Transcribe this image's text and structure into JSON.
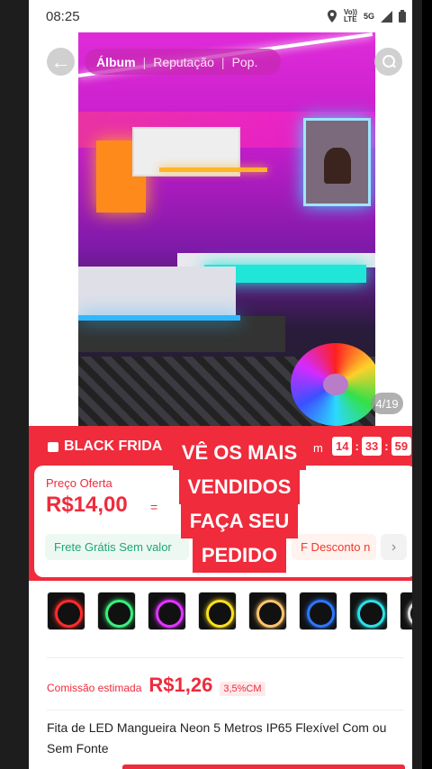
{
  "status_bar": {
    "time": "08:25",
    "volte": "Vo))",
    "lte": "LTE",
    "network": "5G"
  },
  "gallery": {
    "tabs": [
      "Álbum",
      "Reputação",
      "Pop."
    ],
    "separator": "|",
    "counter": "4/19"
  },
  "promo": {
    "banner": "BLACK FRIDA",
    "end_label": "m",
    "timer": [
      "14",
      "33",
      "59"
    ],
    "price_label": "Preço Oferta",
    "price": "R$14,00",
    "equals": "=",
    "chip_free": "Frete Grátis Sem valor",
    "chip_discount": "F Desconto n",
    "chip_arrow": "›"
  },
  "overlay_text": [
    "VÊ OS MAIS",
    "VENDIDOS",
    "FAÇA SEU",
    "PEDIDO"
  ],
  "variants": [
    {
      "color": "#ff2b2b"
    },
    {
      "color": "#39f07a"
    },
    {
      "color": "#e035ff"
    },
    {
      "color": "#ffe01b"
    },
    {
      "color": "#ffc46b"
    },
    {
      "color": "#2b77ff"
    },
    {
      "color": "#2be0e8"
    },
    {
      "color": "#dddddd"
    }
  ],
  "commission": {
    "label": "Comissão estimada",
    "value": "R$1,26",
    "percent": "3,5%CM"
  },
  "product_title": "Fita de LED Mangueira Neon 5 Metros IP65 Flexível Com ou Sem Fonte",
  "colors": {
    "accent": "#ef2b3c",
    "green": "#1ba779"
  }
}
